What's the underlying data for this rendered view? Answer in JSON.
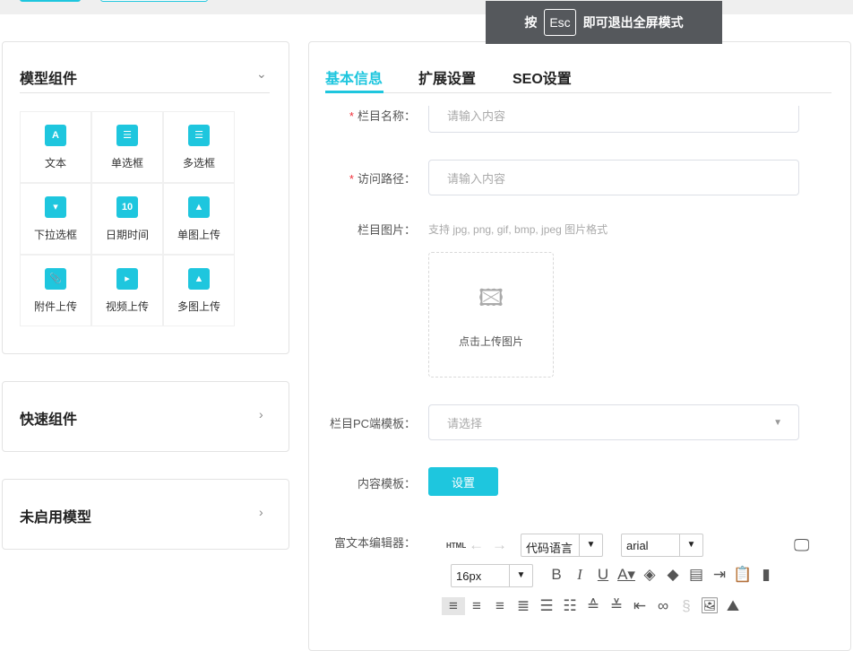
{
  "overlay": {
    "prefix": "按",
    "key": "Esc",
    "suffix": "即可退出全屏模式"
  },
  "left": {
    "model_components": {
      "title": "模型组件",
      "items": [
        {
          "label": "文本",
          "icon": "A"
        },
        {
          "label": "单选框",
          "icon": "☰"
        },
        {
          "label": "多选框",
          "icon": "☰"
        },
        {
          "label": "下拉选框",
          "icon": "▾"
        },
        {
          "label": "日期时间",
          "icon": "10"
        },
        {
          "label": "单图上传",
          "icon": "▲"
        },
        {
          "label": "附件上传",
          "icon": "📎"
        },
        {
          "label": "视频上传",
          "icon": "▸"
        },
        {
          "label": "多图上传",
          "icon": "▲"
        }
      ]
    },
    "quick_components": {
      "title": "快速组件"
    },
    "disabled_models": {
      "title": "未启用模型"
    }
  },
  "tabs": [
    "基本信息",
    "扩展设置",
    "SEO设置"
  ],
  "form": {
    "name_label": "栏目名称：",
    "name_placeholder": "请输入内容",
    "path_label": "访问路径：",
    "path_placeholder": "请输入内容",
    "image_label": "栏目图片：",
    "image_hint": "支持 jpg, png, gif, bmp, jpeg 图片格式",
    "upload_text": "点击上传图片",
    "pc_template_label": "栏目PC端模板：",
    "pc_template_placeholder": "请选择",
    "content_template_label": "内容模板：",
    "content_template_button": "设置",
    "editor_label": "富文本编辑器：",
    "editor": {
      "html": "HTML",
      "code_lang": "代码语言",
      "font": "arial",
      "size": "16px"
    }
  },
  "colors": {
    "accent": "#1ec6de",
    "required": "#f0303a"
  }
}
